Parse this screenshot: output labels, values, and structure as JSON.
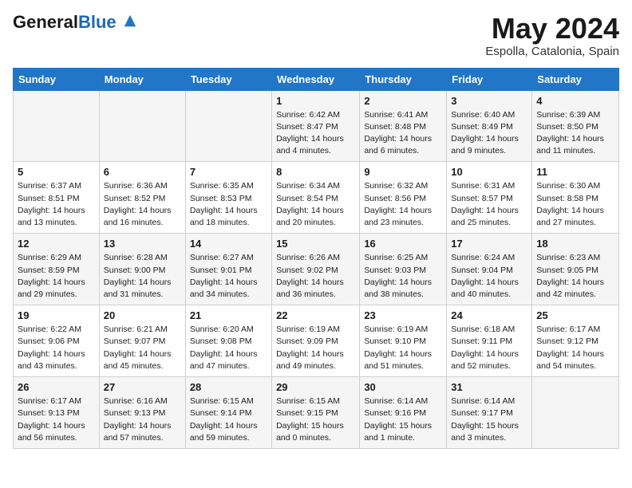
{
  "header": {
    "logo_general": "General",
    "logo_blue": "Blue",
    "month_title": "May 2024",
    "location": "Espolla, Catalonia, Spain"
  },
  "weekdays": [
    "Sunday",
    "Monday",
    "Tuesday",
    "Wednesday",
    "Thursday",
    "Friday",
    "Saturday"
  ],
  "rows": [
    [
      {
        "day": "",
        "info": ""
      },
      {
        "day": "",
        "info": ""
      },
      {
        "day": "",
        "info": ""
      },
      {
        "day": "1",
        "info": "Sunrise: 6:42 AM\nSunset: 8:47 PM\nDaylight: 14 hours\nand 4 minutes."
      },
      {
        "day": "2",
        "info": "Sunrise: 6:41 AM\nSunset: 8:48 PM\nDaylight: 14 hours\nand 6 minutes."
      },
      {
        "day": "3",
        "info": "Sunrise: 6:40 AM\nSunset: 8:49 PM\nDaylight: 14 hours\nand 9 minutes."
      },
      {
        "day": "4",
        "info": "Sunrise: 6:39 AM\nSunset: 8:50 PM\nDaylight: 14 hours\nand 11 minutes."
      }
    ],
    [
      {
        "day": "5",
        "info": "Sunrise: 6:37 AM\nSunset: 8:51 PM\nDaylight: 14 hours\nand 13 minutes."
      },
      {
        "day": "6",
        "info": "Sunrise: 6:36 AM\nSunset: 8:52 PM\nDaylight: 14 hours\nand 16 minutes."
      },
      {
        "day": "7",
        "info": "Sunrise: 6:35 AM\nSunset: 8:53 PM\nDaylight: 14 hours\nand 18 minutes."
      },
      {
        "day": "8",
        "info": "Sunrise: 6:34 AM\nSunset: 8:54 PM\nDaylight: 14 hours\nand 20 minutes."
      },
      {
        "day": "9",
        "info": "Sunrise: 6:32 AM\nSunset: 8:56 PM\nDaylight: 14 hours\nand 23 minutes."
      },
      {
        "day": "10",
        "info": "Sunrise: 6:31 AM\nSunset: 8:57 PM\nDaylight: 14 hours\nand 25 minutes."
      },
      {
        "day": "11",
        "info": "Sunrise: 6:30 AM\nSunset: 8:58 PM\nDaylight: 14 hours\nand 27 minutes."
      }
    ],
    [
      {
        "day": "12",
        "info": "Sunrise: 6:29 AM\nSunset: 8:59 PM\nDaylight: 14 hours\nand 29 minutes."
      },
      {
        "day": "13",
        "info": "Sunrise: 6:28 AM\nSunset: 9:00 PM\nDaylight: 14 hours\nand 31 minutes."
      },
      {
        "day": "14",
        "info": "Sunrise: 6:27 AM\nSunset: 9:01 PM\nDaylight: 14 hours\nand 34 minutes."
      },
      {
        "day": "15",
        "info": "Sunrise: 6:26 AM\nSunset: 9:02 PM\nDaylight: 14 hours\nand 36 minutes."
      },
      {
        "day": "16",
        "info": "Sunrise: 6:25 AM\nSunset: 9:03 PM\nDaylight: 14 hours\nand 38 minutes."
      },
      {
        "day": "17",
        "info": "Sunrise: 6:24 AM\nSunset: 9:04 PM\nDaylight: 14 hours\nand 40 minutes."
      },
      {
        "day": "18",
        "info": "Sunrise: 6:23 AM\nSunset: 9:05 PM\nDaylight: 14 hours\nand 42 minutes."
      }
    ],
    [
      {
        "day": "19",
        "info": "Sunrise: 6:22 AM\nSunset: 9:06 PM\nDaylight: 14 hours\nand 43 minutes."
      },
      {
        "day": "20",
        "info": "Sunrise: 6:21 AM\nSunset: 9:07 PM\nDaylight: 14 hours\nand 45 minutes."
      },
      {
        "day": "21",
        "info": "Sunrise: 6:20 AM\nSunset: 9:08 PM\nDaylight: 14 hours\nand 47 minutes."
      },
      {
        "day": "22",
        "info": "Sunrise: 6:19 AM\nSunset: 9:09 PM\nDaylight: 14 hours\nand 49 minutes."
      },
      {
        "day": "23",
        "info": "Sunrise: 6:19 AM\nSunset: 9:10 PM\nDaylight: 14 hours\nand 51 minutes."
      },
      {
        "day": "24",
        "info": "Sunrise: 6:18 AM\nSunset: 9:11 PM\nDaylight: 14 hours\nand 52 minutes."
      },
      {
        "day": "25",
        "info": "Sunrise: 6:17 AM\nSunset: 9:12 PM\nDaylight: 14 hours\nand 54 minutes."
      }
    ],
    [
      {
        "day": "26",
        "info": "Sunrise: 6:17 AM\nSunset: 9:13 PM\nDaylight: 14 hours\nand 56 minutes."
      },
      {
        "day": "27",
        "info": "Sunrise: 6:16 AM\nSunset: 9:13 PM\nDaylight: 14 hours\nand 57 minutes."
      },
      {
        "day": "28",
        "info": "Sunrise: 6:15 AM\nSunset: 9:14 PM\nDaylight: 14 hours\nand 59 minutes."
      },
      {
        "day": "29",
        "info": "Sunrise: 6:15 AM\nSunset: 9:15 PM\nDaylight: 15 hours\nand 0 minutes."
      },
      {
        "day": "30",
        "info": "Sunrise: 6:14 AM\nSunset: 9:16 PM\nDaylight: 15 hours\nand 1 minute."
      },
      {
        "day": "31",
        "info": "Sunrise: 6:14 AM\nSunset: 9:17 PM\nDaylight: 15 hours\nand 3 minutes."
      },
      {
        "day": "",
        "info": ""
      }
    ]
  ]
}
